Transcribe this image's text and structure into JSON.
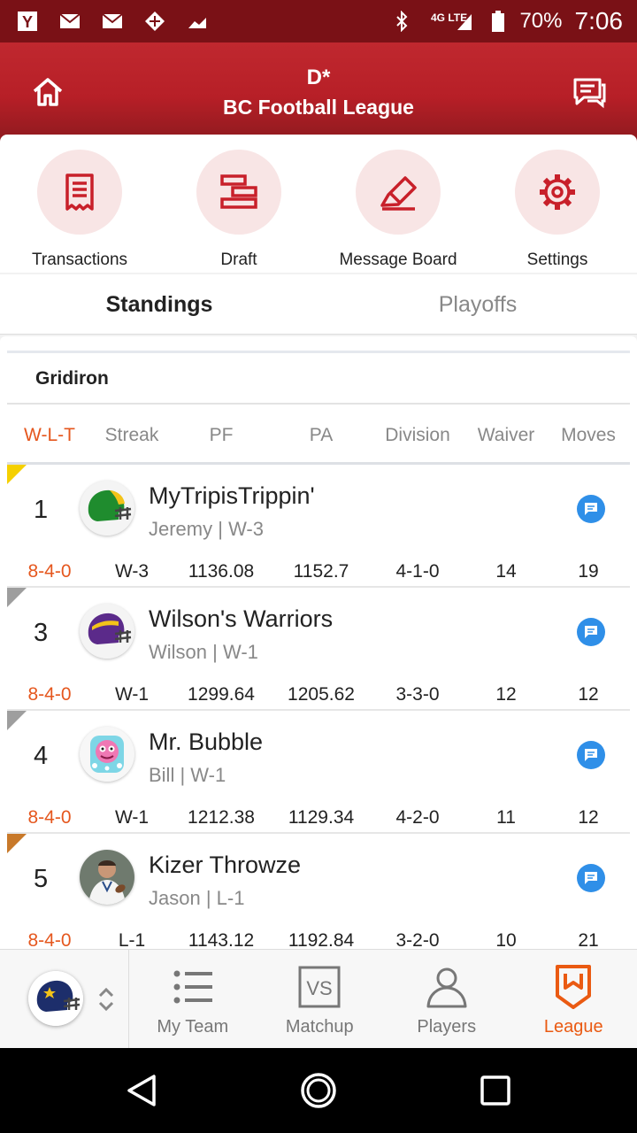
{
  "status_bar": {
    "battery": "70%",
    "time": "7:06",
    "network": "4G LTE",
    "left_icons": [
      "yahoo-icon",
      "mail-icon",
      "mail-icon",
      "sports-icon",
      "trend-icon"
    ]
  },
  "header": {
    "league_abbr": "D*",
    "league_name": "BC Football League"
  },
  "actions": [
    {
      "label": "Transactions",
      "icon": "receipt-icon"
    },
    {
      "label": "Draft",
      "icon": "draft-board-icon"
    },
    {
      "label": "Message Board",
      "icon": "pencil-icon"
    },
    {
      "label": "Settings",
      "icon": "gear-icon"
    }
  ],
  "tabs": {
    "standings": "Standings",
    "playoffs": "Playoffs"
  },
  "group": {
    "title": "Gridiron"
  },
  "columns": {
    "record": "W-L-T",
    "streak": "Streak",
    "pf": "PF",
    "pa": "PA",
    "division": "Division",
    "waiver": "Waiver",
    "moves": "Moves"
  },
  "rows": [
    {
      "rank": "1",
      "team": "MyTripisTrippin'",
      "sub": "Jeremy | W-3",
      "record": "8-4-0",
      "streak": "W-3",
      "pf": "1136.08",
      "pa": "1152.7",
      "division": "4-1-0",
      "waiver": "14",
      "moves": "19",
      "flag_color": "#f5d000",
      "avatar": "green-helmet"
    },
    {
      "rank": "3",
      "team": "Wilson's Warriors",
      "sub": "Wilson | W-1",
      "record": "8-4-0",
      "streak": "W-1",
      "pf": "1299.64",
      "pa": "1205.62",
      "division": "3-3-0",
      "waiver": "12",
      "moves": "12",
      "flag_color": "#9e9e9e",
      "avatar": "purple-helmet"
    },
    {
      "rank": "4",
      "team": "Mr. Bubble",
      "sub": "Bill | W-1",
      "record": "8-4-0",
      "streak": "W-1",
      "pf": "1212.38",
      "pa": "1129.34",
      "division": "4-2-0",
      "waiver": "11",
      "moves": "12",
      "flag_color": "#9e9e9e",
      "avatar": "bubble-logo"
    },
    {
      "rank": "5",
      "team": "Kizer Throwze",
      "sub": "Jason | L-1",
      "record": "8-4-0",
      "streak": "L-1",
      "pf": "1143.12",
      "pa": "1192.84",
      "division": "3-2-0",
      "waiver": "10",
      "moves": "21",
      "flag_color": "#c8792a",
      "avatar": "player-photo"
    }
  ],
  "bottom_nav": {
    "my_team": "My Team",
    "matchup": "Matchup",
    "players": "Players",
    "league": "League",
    "vs_glyph": "VS"
  },
  "colors": {
    "brand_red": "#b71f27",
    "accent_orange": "#e5571e",
    "message_blue": "#2f8fe8"
  }
}
